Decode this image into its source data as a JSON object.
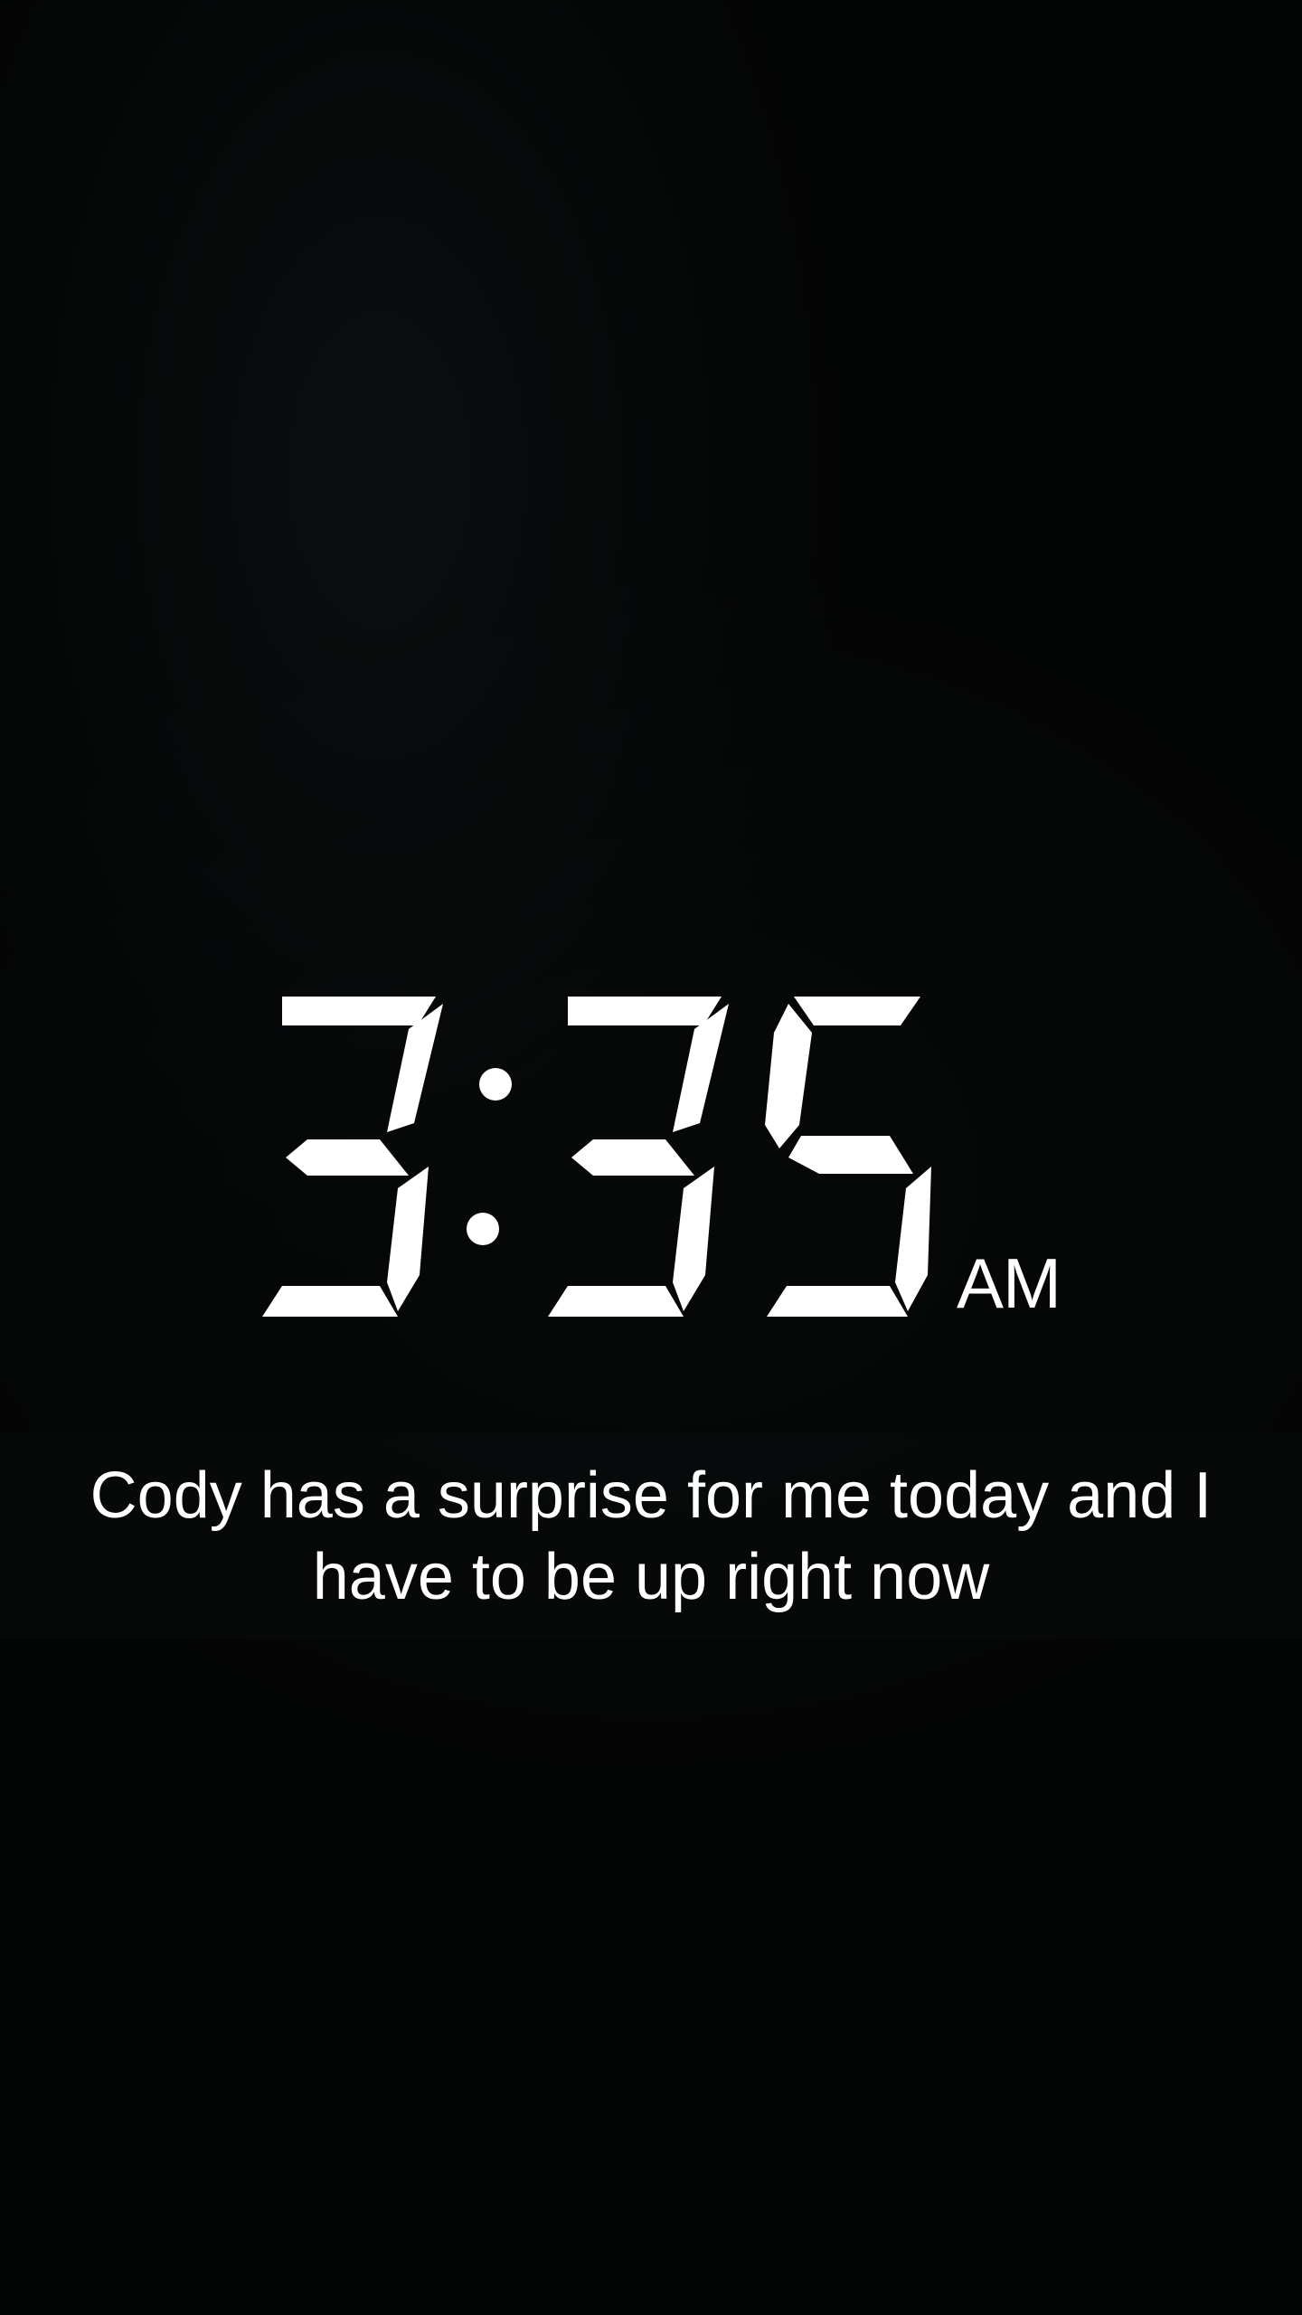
{
  "clock": {
    "time": "3:35",
    "digits": [
      "3",
      "3",
      "5"
    ],
    "period": "AM",
    "digit_color": "#ffffff"
  },
  "caption": {
    "text": "Cody has a surprise for me today and I have to be up right now"
  },
  "colors": {
    "background": "#030404",
    "caption_bar": "#080a0a",
    "text": "#ffffff"
  }
}
